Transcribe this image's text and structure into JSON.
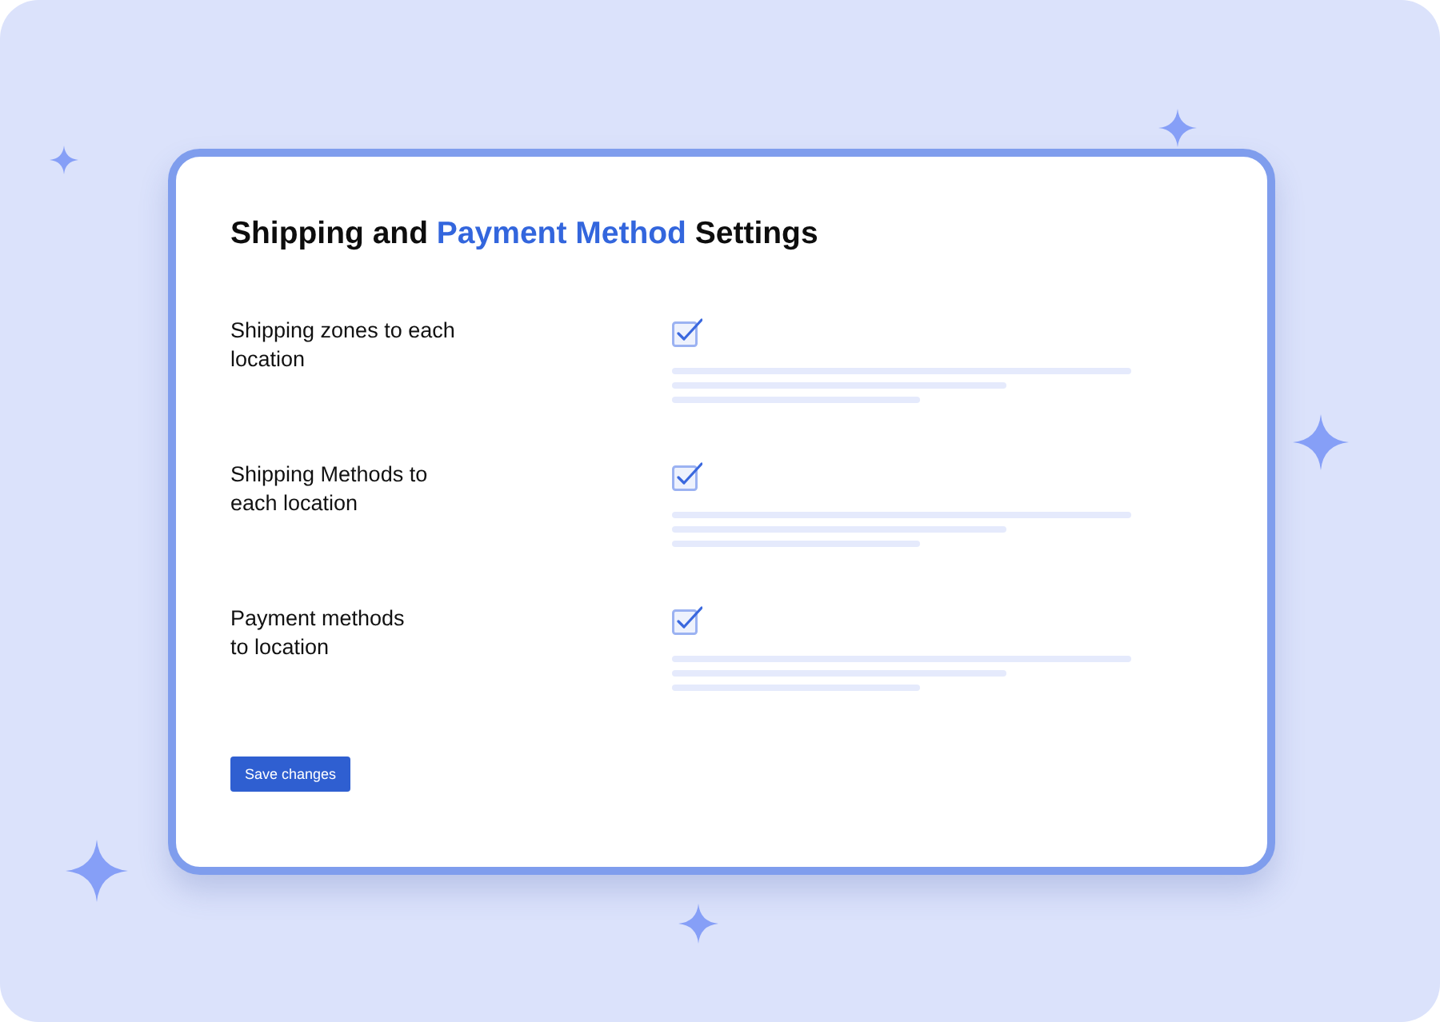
{
  "title": {
    "parts": [
      {
        "text": "Shipping and",
        "accent": false
      },
      {
        "text": "Payment Method",
        "accent": true
      },
      {
        "text": "Settings",
        "accent": false
      }
    ]
  },
  "settings": [
    {
      "label_lines": [
        "Shipping zones to each",
        "location"
      ],
      "checked": true
    },
    {
      "label_lines": [
        "Shipping Methods to",
        "each location"
      ],
      "checked": true
    },
    {
      "label_lines": [
        "Payment methods",
        "to location"
      ],
      "checked": true
    }
  ],
  "save_button": {
    "label": "Save changes"
  }
}
